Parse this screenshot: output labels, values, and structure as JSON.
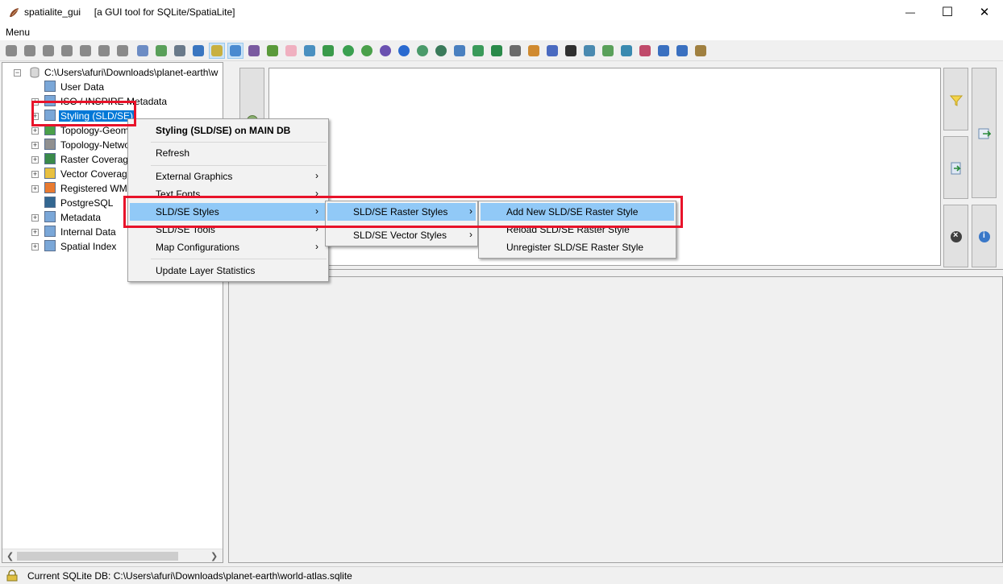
{
  "window": {
    "app_name": "spatialite_gui",
    "subtitle": "[a GUI tool for SQLite/SpatiaLite]",
    "minimize_glyph": "—",
    "maximize_glyph": "☐",
    "close_glyph": "✕"
  },
  "menubar": {
    "menu_label": "Menu"
  },
  "toolbar": {
    "icon_colors": [
      "#8a8a8a",
      "#8a8a8a",
      "#8a8a8a",
      "#8a8a8a",
      "#8a8a8a",
      "#8a8a8a",
      "#8a8a8a",
      "#6c8cc4",
      "#5aa05a",
      "#6a7a8a",
      "#3a76c0",
      "#c8b040",
      "#4a8ad0",
      "#7a5aa0",
      "#5a9a3a",
      "#f0b0c0",
      "#4a90c0",
      "#3a9a4a",
      "#3aa050",
      "#4aa04a",
      "#6a50b0",
      "#2a6ad0",
      "#4a9a6a",
      "#3a7a5a",
      "#4a80c0",
      "#3a9a5a",
      "#2a8a4a",
      "#6a6a6a",
      "#d08a30",
      "#4a6ac0",
      "#303030",
      "#4a8ab0",
      "#5aa05a",
      "#3a8ab0",
      "#c04a6a",
      "#3a70c0",
      "#3a70c0",
      "#a08040"
    ],
    "pressed_indices": [
      11,
      12
    ]
  },
  "tree": {
    "root_path": "C:\\Users\\afuri\\Downloads\\planet-earth\\w",
    "items": [
      {
        "label": "User Data"
      },
      {
        "label": "ISO / INSPIRE Metadata"
      },
      {
        "label": "Styling (SLD/SE)"
      },
      {
        "label": "Topology-Geometries"
      },
      {
        "label": "Topology-Network"
      },
      {
        "label": "Raster Coverages"
      },
      {
        "label": "Vector Coverages"
      },
      {
        "label": "Registered WMS"
      },
      {
        "label": "PostgreSQL"
      },
      {
        "label": "Metadata"
      },
      {
        "label": "Internal Data"
      },
      {
        "label": "Spatial Index"
      }
    ]
  },
  "context_menu": {
    "header": "Styling (SLD/SE) on MAIN DB",
    "refresh": "Refresh",
    "external_graphics": "External Graphics",
    "text_fonts": "Text Fonts",
    "sld_se_styles": "SLD/SE Styles",
    "sld_se_tools": "SLD/SE Tools",
    "map_configurations": "Map Configurations",
    "update_layer_statistics": "Update Layer Statistics"
  },
  "styles_submenu": {
    "raster_styles": "SLD/SE Raster Styles",
    "vector_styles": "SLD/SE Vector Styles"
  },
  "raster_submenu": {
    "add_new": "Add New SLD/SE Raster Style",
    "reload": "Reload SLD/SE Raster Style",
    "unregister": "Unregister SLD/SE Raster Style"
  },
  "statusbar": {
    "text": "Current SQLite DB: C:\\Users\\afuri\\Downloads\\planet-earth\\world-atlas.sqlite"
  },
  "colors": {
    "highlight": "#91c9f7",
    "selection": "#0078d7",
    "annotation_red": "#e8132a"
  }
}
